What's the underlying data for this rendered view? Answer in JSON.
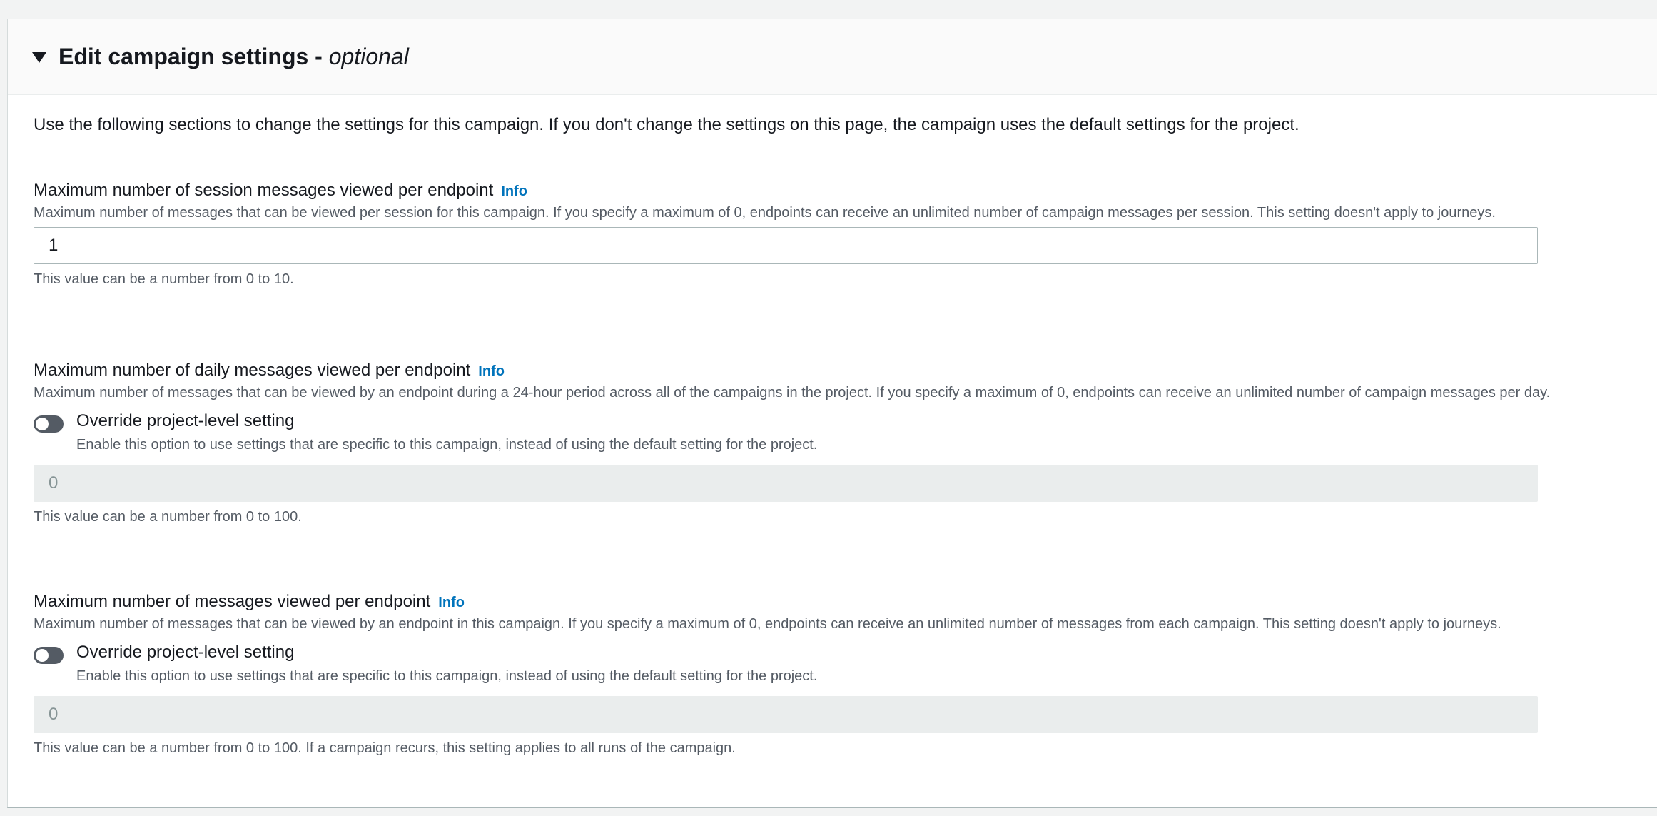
{
  "section": {
    "title": "Edit campaign settings - ",
    "title_optional": "optional",
    "intro": "Use the following sections to change the settings for this campaign. If you don't change the settings on this page, the campaign uses the default settings for the project."
  },
  "fields": [
    {
      "label": "Maximum number of session messages viewed per endpoint",
      "info": "Info",
      "description": "Maximum number of messages that can be viewed per session for this campaign. If you specify a maximum of 0, endpoints can receive an unlimited number of campaign messages per session. This setting doesn't apply to journeys.",
      "value": "1",
      "hint": "This value can be a number from 0 to 10."
    },
    {
      "label": "Maximum number of daily messages viewed per endpoint",
      "info": "Info",
      "description": "Maximum number of messages that can be viewed by an endpoint during a 24-hour period across all of the campaigns in the project. If you specify a maximum of 0, endpoints can receive an unlimited number of campaign messages per day.",
      "toggle_label": "Override project-level setting",
      "toggle_on": false,
      "toggle_description": "Enable this option to use settings that are specific to this campaign, instead of using the default setting for the project.",
      "value": "0",
      "hint": "This value can be a number from 0 to 100."
    },
    {
      "label": "Maximum number of messages viewed per endpoint",
      "info": "Info",
      "description": "Maximum number of messages that can be viewed by an endpoint in this campaign. If you specify a maximum of 0, endpoints can receive an unlimited number of messages from each campaign. This setting doesn't apply to journeys.",
      "toggle_label": "Override project-level setting",
      "toggle_on": false,
      "toggle_description": "Enable this option to use settings that are specific to this campaign, instead of using the default setting for the project.",
      "value": "0",
      "hint": "This value can be a number from 0 to 100. If a campaign recurs, this setting applies to all runs of the campaign."
    }
  ],
  "colors": {
    "link": "#0073bb",
    "toggle_off": "#545b64",
    "disabled_input": "#eaeded"
  },
  "icons": {
    "expand": "caret-down-icon"
  }
}
